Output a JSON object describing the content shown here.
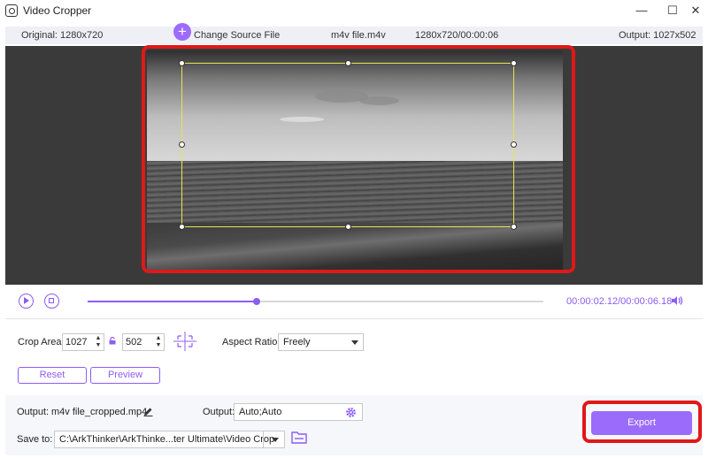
{
  "window": {
    "title": "Video Cropper",
    "minimize_glyph": "—",
    "maximize_glyph": "☐",
    "close_glyph": "✕"
  },
  "infobar": {
    "original": "Original: 1280x720",
    "change_source_label": "Change Source File",
    "file_name": "m4v file.m4v",
    "file_info": "1280x720/00:00:06",
    "output": "Output: 1027x502"
  },
  "playback": {
    "current_time": "00:00:02.12",
    "total_time": "/00:00:06.18",
    "progress_fraction": 0.37
  },
  "crop": {
    "area_label": "Crop Area:",
    "width": "1027",
    "height": "502",
    "aspect_label": "Aspect Ratio:",
    "aspect_value": "Freely",
    "reset_label": "Reset",
    "preview_label": "Preview"
  },
  "output": {
    "label": "Output:",
    "file_name": "m4v file_cropped.mp4",
    "format_label": "Output:",
    "format_value": "Auto;Auto",
    "save_label": "Save to:",
    "save_path": "C:\\ArkThinker\\ArkThinke...ter Ultimate\\Video Crop",
    "export_label": "Export"
  },
  "colors": {
    "accent": "#8b5cf6",
    "highlight": "#e01818"
  }
}
